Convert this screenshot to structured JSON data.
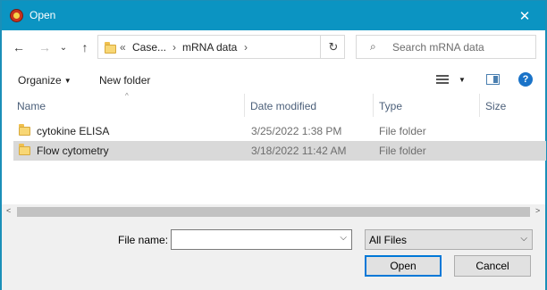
{
  "window": {
    "title": "Open",
    "close_glyph": "✕"
  },
  "nav": {
    "back_glyph": "←",
    "forward_glyph": "→",
    "recent_glyph": "⌄",
    "up_glyph": "↑",
    "breadcrumb": {
      "overflow": "«",
      "items": [
        "Case...",
        "mRNA data"
      ],
      "separator": "›"
    },
    "refresh_glyph": "↻"
  },
  "search": {
    "placeholder": "Search mRNA data",
    "icon_glyph": "⌕"
  },
  "toolbar": {
    "organize_label": "Organize",
    "organize_caret": "▼",
    "new_folder_label": "New folder",
    "view_caret": "▼",
    "help_glyph": "?"
  },
  "columns": {
    "name": "Name",
    "date_modified": "Date modified",
    "type": "Type",
    "size": "Size",
    "sort_glyph": "^"
  },
  "files": [
    {
      "name": "cytokine ELISA",
      "date": "3/25/2022 1:38 PM",
      "type": "File folder",
      "size": ""
    },
    {
      "name": "Flow cytometry",
      "date": "3/18/2022 11:42 AM",
      "type": "File folder",
      "size": ""
    }
  ],
  "scrollbar": {
    "left_glyph": "<",
    "right_glyph": ">"
  },
  "bottom": {
    "file_name_label": "File name:",
    "file_name_value": "",
    "file_name_drop": "⌵",
    "filter_value": "All Files",
    "filter_drop": "⌵",
    "open_label": "Open",
    "cancel_label": "Cancel"
  },
  "colors": {
    "titlebar": "#0b94c2",
    "selected_row": "#d9d9d9",
    "accent": "#0078d7"
  }
}
